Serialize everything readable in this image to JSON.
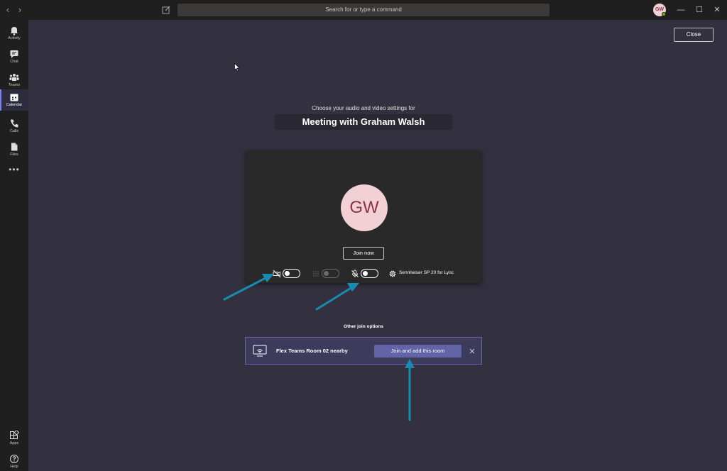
{
  "titlebar": {
    "search_placeholder": "Search for or type a command",
    "user_initials": "GW",
    "back_glyph": "‹",
    "forward_glyph": "›",
    "minimize_glyph": "—",
    "maximize_glyph": "☐",
    "close_glyph": "✕"
  },
  "rail": {
    "items": [
      {
        "label": "Activity",
        "icon": "bell-icon"
      },
      {
        "label": "Chat",
        "icon": "chat-icon"
      },
      {
        "label": "Teams",
        "icon": "teams-icon"
      },
      {
        "label": "Calendar",
        "icon": "calendar-icon",
        "active": true
      },
      {
        "label": "Calls",
        "icon": "phone-icon"
      },
      {
        "label": "Files",
        "icon": "file-icon"
      }
    ],
    "more": "•••",
    "apps_label": "Apps",
    "help_label": "Help"
  },
  "close_label": "Close",
  "subtitle": "Choose your audio and video settings for",
  "meeting_title": "Meeting with Graham Walsh",
  "preview": {
    "initials": "GW",
    "join_label": "Join now",
    "video_on": false,
    "blur_on": false,
    "mic_on": false,
    "device": "Sennheiser SP 20 for Lync"
  },
  "other_join_label": "Other join options",
  "room": {
    "name": "Flex Teams Room 02 nearby",
    "join_label": "Join and add this room"
  },
  "colors": {
    "accent": "#6264a7",
    "arrow": "#1a8bb0",
    "avatar_bg": "#f2d0d5",
    "avatar_text": "#8a3545"
  }
}
